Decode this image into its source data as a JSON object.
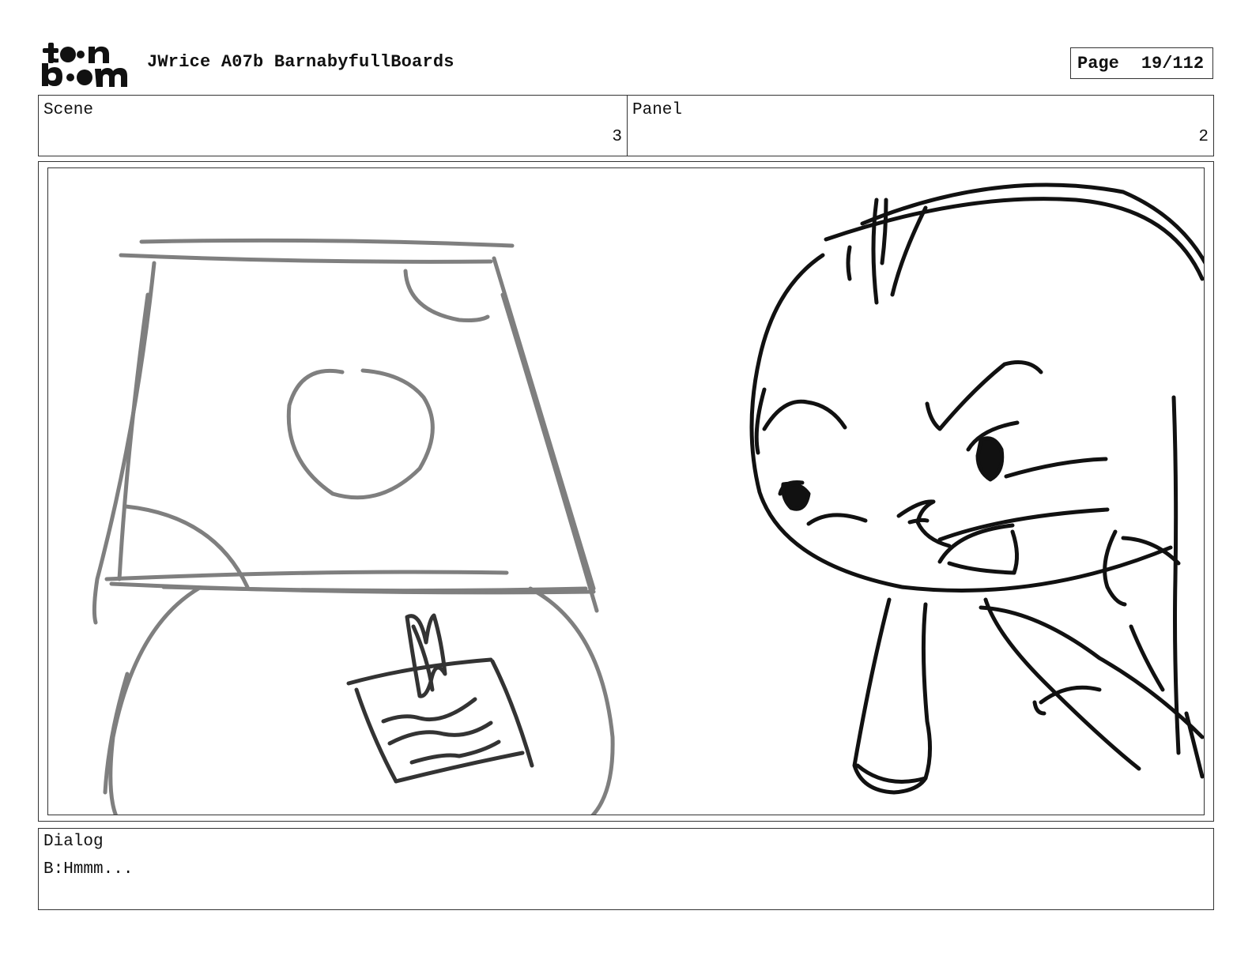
{
  "header": {
    "logo_text": "toon boom",
    "project_title": "JWrice A07b BarnabyfullBoards",
    "page_label": "Page",
    "page_number": "19/112"
  },
  "scene": {
    "label": "Scene",
    "value": "3"
  },
  "panel": {
    "label": "Panel",
    "value": "2"
  },
  "dialog": {
    "label": "Dialog",
    "text": "B:Hmmm..."
  },
  "colors": {
    "line_dark": "#111111",
    "line_grey": "#808080",
    "border": "#333333"
  }
}
